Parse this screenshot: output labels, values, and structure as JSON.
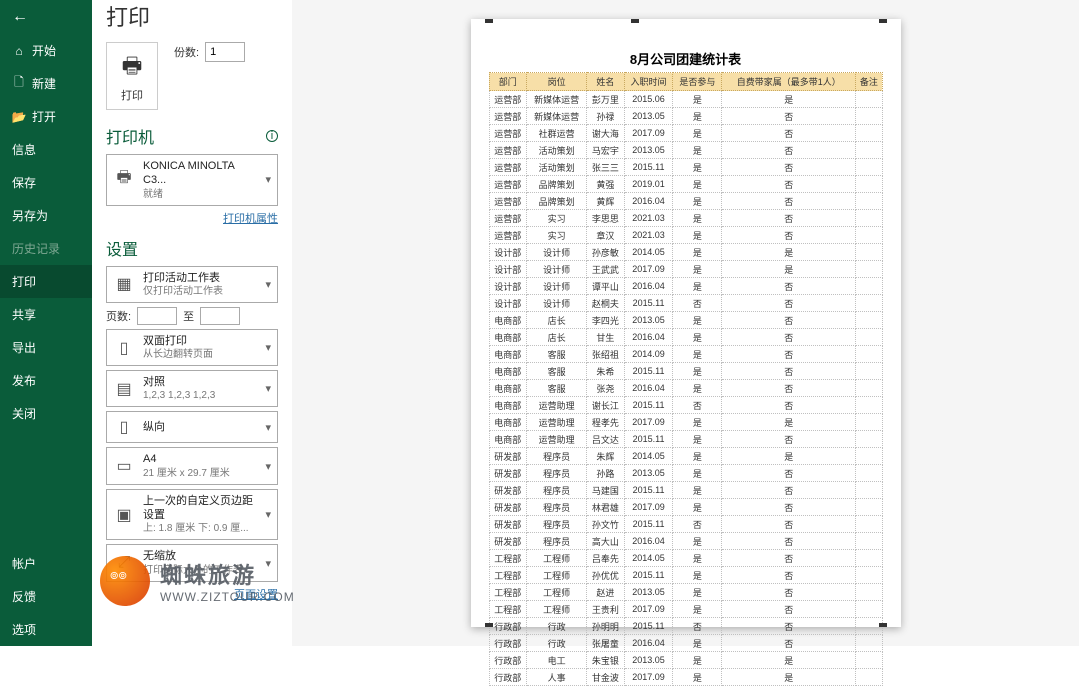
{
  "page_title": "打印",
  "sidebar": {
    "items": [
      {
        "label": "开始",
        "icon": "⌂"
      },
      {
        "label": "新建",
        "icon": "🗋"
      },
      {
        "label": "打开",
        "icon": "📂"
      },
      {
        "label": "信息"
      },
      {
        "label": "保存"
      },
      {
        "label": "另存为"
      },
      {
        "label": "历史记录",
        "disabled": true
      },
      {
        "label": "打印",
        "active": true
      },
      {
        "label": "共享"
      },
      {
        "label": "导出"
      },
      {
        "label": "发布"
      },
      {
        "label": "关闭"
      }
    ],
    "bottom": [
      {
        "label": "帐户"
      },
      {
        "label": "反馈"
      },
      {
        "label": "选项"
      }
    ]
  },
  "print": {
    "button_label": "打印",
    "copies_label": "份数:",
    "copies_value": "1"
  },
  "printer": {
    "section_title": "打印机",
    "name": "KONICA MINOLTA C3...",
    "status": "就绪",
    "props_link": "打印机属性"
  },
  "settings": {
    "section_title": "设置",
    "sheet": {
      "l1": "打印活动工作表",
      "l2": "仅打印活动工作表"
    },
    "pages_label": "页数:",
    "pages_to": "至",
    "duplex": {
      "l1": "双面打印",
      "l2": "从长边翻转页面"
    },
    "collate": {
      "l1": "对照",
      "l2": "1,2,3   1,2,3   1,2,3"
    },
    "orientation": {
      "l1": "纵向",
      "l2": ""
    },
    "paper": {
      "l1": "A4",
      "l2": "21 厘米 x 29.7 厘米"
    },
    "margins": {
      "l1": "上一次的自定义页边距设置",
      "l2": "上: 1.8 厘米 下: 0.9 厘..."
    },
    "scaling": {
      "l1": "无缩放",
      "l2": "打印实际大小的工作表"
    },
    "page_setup_link": "页面设置"
  },
  "watermark": {
    "l1": "蜘蛛旅游",
    "l2": "WWW.ZIZTOUR.COM"
  },
  "preview": {
    "title": "8月公司团建统计表",
    "headers": [
      "部门",
      "岗位",
      "姓名",
      "入职时间",
      "是否参与",
      "自费带家属（最多带1人）",
      "备注"
    ],
    "rows": [
      [
        "运营部",
        "新媒体运营",
        "彭万里",
        "2015.06",
        "是",
        "是",
        ""
      ],
      [
        "运营部",
        "新媒体运营",
        "孙禄",
        "2013.05",
        "是",
        "否",
        ""
      ],
      [
        "运营部",
        "社群运营",
        "谢大海",
        "2017.09",
        "是",
        "否",
        ""
      ],
      [
        "运营部",
        "活动策划",
        "马宏宇",
        "2013.05",
        "是",
        "否",
        ""
      ],
      [
        "运营部",
        "活动策划",
        "张三三",
        "2015.11",
        "是",
        "否",
        ""
      ],
      [
        "运营部",
        "品牌策划",
        "黄强",
        "2019.01",
        "是",
        "否",
        ""
      ],
      [
        "运营部",
        "品牌策划",
        "黄辉",
        "2016.04",
        "是",
        "否",
        ""
      ],
      [
        "运营部",
        "实习",
        "李思思",
        "2021.03",
        "是",
        "否",
        ""
      ],
      [
        "运营部",
        "实习",
        "章汉",
        "2021.03",
        "是",
        "否",
        ""
      ],
      [
        "设计部",
        "设计师",
        "孙彦敏",
        "2014.05",
        "是",
        "是",
        ""
      ],
      [
        "设计部",
        "设计师",
        "王武武",
        "2017.09",
        "是",
        "是",
        ""
      ],
      [
        "设计部",
        "设计师",
        "谭平山",
        "2016.04",
        "是",
        "否",
        ""
      ],
      [
        "设计部",
        "设计师",
        "赵桐夫",
        "2015.11",
        "否",
        "否",
        ""
      ],
      [
        "电商部",
        "店长",
        "李四光",
        "2013.05",
        "是",
        "否",
        ""
      ],
      [
        "电商部",
        "店长",
        "甘生",
        "2016.04",
        "是",
        "否",
        ""
      ],
      [
        "电商部",
        "客服",
        "张绍祖",
        "2014.09",
        "是",
        "否",
        ""
      ],
      [
        "电商部",
        "客服",
        "朱希",
        "2015.11",
        "是",
        "否",
        ""
      ],
      [
        "电商部",
        "客服",
        "张尧",
        "2016.04",
        "是",
        "否",
        ""
      ],
      [
        "电商部",
        "运营助理",
        "谢长江",
        "2015.11",
        "否",
        "否",
        ""
      ],
      [
        "电商部",
        "运营助理",
        "程孝先",
        "2017.09",
        "是",
        "是",
        ""
      ],
      [
        "电商部",
        "运营助理",
        "吕文达",
        "2015.11",
        "是",
        "否",
        ""
      ],
      [
        "研发部",
        "程序员",
        "朱辉",
        "2014.05",
        "是",
        "是",
        ""
      ],
      [
        "研发部",
        "程序员",
        "孙路",
        "2013.05",
        "是",
        "否",
        ""
      ],
      [
        "研发部",
        "程序员",
        "马建国",
        "2015.11",
        "是",
        "否",
        ""
      ],
      [
        "研发部",
        "程序员",
        "林君雄",
        "2017.09",
        "是",
        "否",
        ""
      ],
      [
        "研发部",
        "程序员",
        "孙文竹",
        "2015.11",
        "否",
        "否",
        ""
      ],
      [
        "研发部",
        "程序员",
        "高大山",
        "2016.04",
        "是",
        "否",
        ""
      ],
      [
        "工程部",
        "工程师",
        "吕奉先",
        "2014.05",
        "是",
        "否",
        ""
      ],
      [
        "工程部",
        "工程师",
        "孙优优",
        "2015.11",
        "是",
        "否",
        ""
      ],
      [
        "工程部",
        "工程师",
        "赵进",
        "2013.05",
        "是",
        "否",
        ""
      ],
      [
        "工程部",
        "工程师",
        "王贵利",
        "2017.09",
        "是",
        "否",
        ""
      ],
      [
        "行政部",
        "行政",
        "孙明明",
        "2015.11",
        "否",
        "否",
        ""
      ],
      [
        "行政部",
        "行政",
        "张屠童",
        "2016.04",
        "是",
        "否",
        ""
      ],
      [
        "行政部",
        "电工",
        "朱宝银",
        "2013.05",
        "是",
        "是",
        ""
      ],
      [
        "行政部",
        "人事",
        "甘金波",
        "2017.09",
        "是",
        "是",
        ""
      ]
    ]
  }
}
